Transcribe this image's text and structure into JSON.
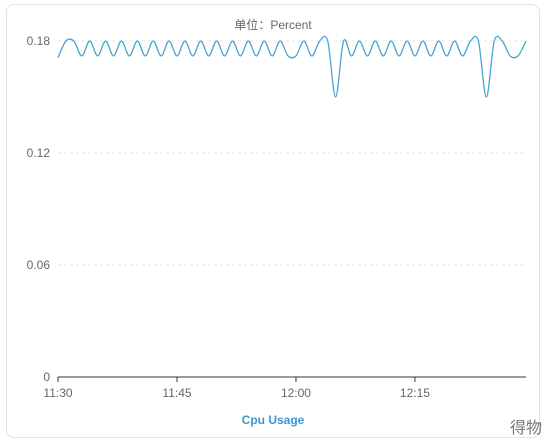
{
  "chart_data": {
    "type": "line",
    "title": "",
    "unit_label": "单位：Percent",
    "xlabel": "",
    "ylabel": "",
    "xlim": [
      "11:30",
      "12:29"
    ],
    "ylim": [
      0,
      0.18
    ],
    "y_ticks": [
      "0",
      "0.06",
      "0.12",
      "0.18"
    ],
    "x_ticks": [
      "11:30",
      "11:45",
      "12:00",
      "12:15"
    ],
    "grid": true,
    "legend_position": "bottom",
    "colors": {
      "line": "#4aa3d1",
      "grid": "#e6e6e6",
      "axis": "#333333",
      "legend": "#3a97cf"
    },
    "series": [
      {
        "name": "Cpu Usage",
        "x": [
          "11:30",
          "11:31",
          "11:32",
          "11:33",
          "11:34",
          "11:35",
          "11:36",
          "11:37",
          "11:38",
          "11:39",
          "11:40",
          "11:41",
          "11:42",
          "11:43",
          "11:44",
          "11:45",
          "11:46",
          "11:47",
          "11:48",
          "11:49",
          "11:50",
          "11:51",
          "11:52",
          "11:53",
          "11:54",
          "11:55",
          "11:56",
          "11:57",
          "11:58",
          "11:59",
          "12:00",
          "12:01",
          "12:02",
          "12:03",
          "12:04",
          "12:05",
          "12:06",
          "12:07",
          "12:08",
          "12:09",
          "12:10",
          "12:11",
          "12:12",
          "12:13",
          "12:14",
          "12:15",
          "12:16",
          "12:17",
          "12:18",
          "12:19",
          "12:20",
          "12:21",
          "12:22",
          "12:23",
          "12:24",
          "12:25",
          "12:26",
          "12:27",
          "12:28",
          "12:29"
        ],
        "values": [
          0.171,
          0.18,
          0.18,
          0.172,
          0.18,
          0.172,
          0.18,
          0.172,
          0.18,
          0.172,
          0.18,
          0.172,
          0.18,
          0.172,
          0.18,
          0.172,
          0.18,
          0.172,
          0.18,
          0.172,
          0.18,
          0.172,
          0.18,
          0.172,
          0.18,
          0.172,
          0.18,
          0.172,
          0.18,
          0.172,
          0.172,
          0.18,
          0.172,
          0.18,
          0.18,
          0.15,
          0.18,
          0.172,
          0.18,
          0.172,
          0.18,
          0.172,
          0.18,
          0.172,
          0.18,
          0.172,
          0.18,
          0.172,
          0.18,
          0.172,
          0.18,
          0.172,
          0.18,
          0.18,
          0.15,
          0.18,
          0.18,
          0.172,
          0.172,
          0.18
        ]
      }
    ]
  },
  "watermark": "得物"
}
